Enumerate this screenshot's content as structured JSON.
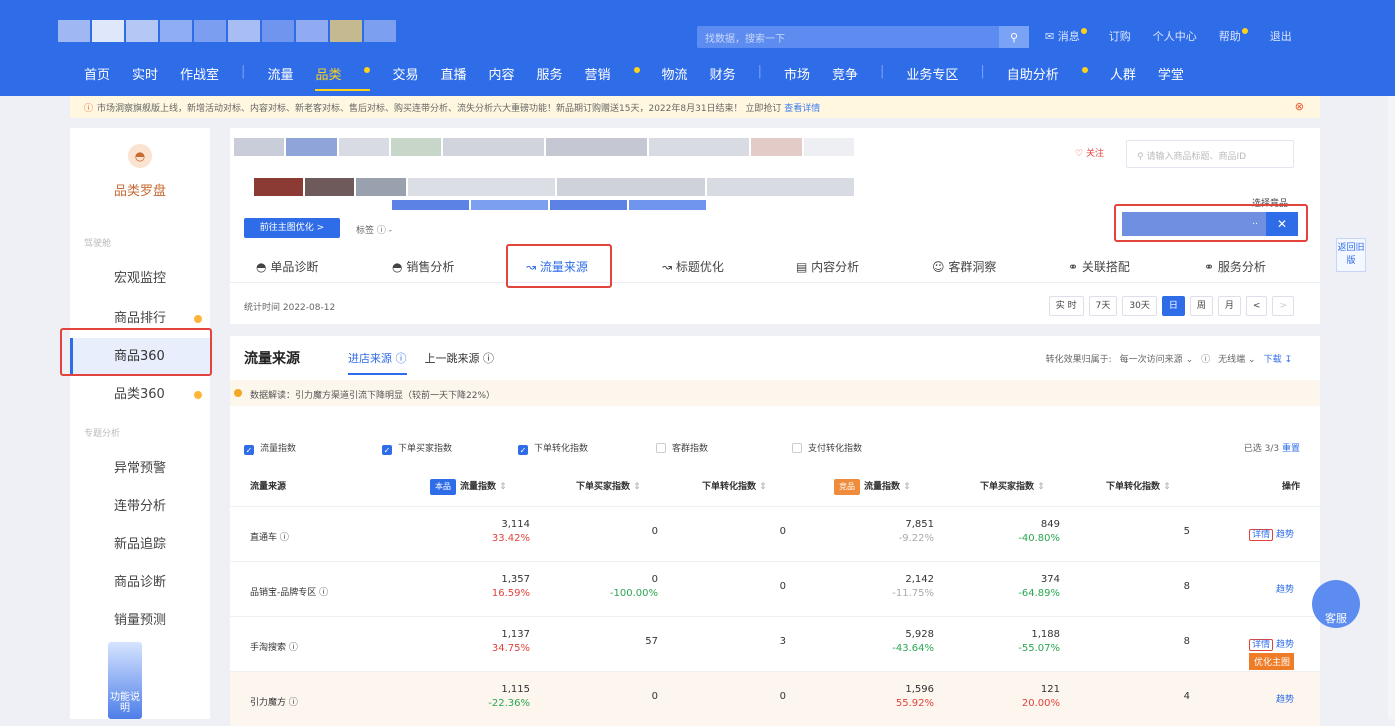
{
  "header": {
    "search_placeholder": "找数据，搜索一下",
    "links": [
      "消息",
      "订购",
      "个人中心",
      "帮助",
      "退出"
    ],
    "nav": [
      "首页",
      "实时",
      "作战室",
      "流量",
      "品类",
      "交易",
      "直播",
      "内容",
      "服务",
      "营销",
      "物流",
      "财务",
      "市场",
      "竞争",
      "业务专区",
      "自助分析",
      "人群",
      "学堂"
    ]
  },
  "notice": {
    "text": "市场洞察旗舰版上线，新增活动对标、内容对标、新老客对标、售后对标、购买连带分析、流失分析六大重磅功能！新品期订购赠送15天，2022年8月31日结束！ 立即抢订",
    "link": "查看详情"
  },
  "sidebar": {
    "title": "品类罗盘",
    "group1": "驾驶舱",
    "group2": "专题分析",
    "items": [
      "宏观监控",
      "商品排行",
      "商品360",
      "品类360",
      "异常预警",
      "连带分析",
      "新品追踪",
      "商品诊断",
      "销量预测"
    ],
    "helper": "功能说明"
  },
  "product": {
    "optimize_btn": "前往主图优化 >",
    "tag_label": "标签",
    "tag_value": "-",
    "follow": "关注",
    "search_placeholder": "请输入商品标题、商品ID",
    "choose_label": "选择竞品",
    "choose_dots": "..",
    "tabs": [
      "单品诊断",
      "销售分析",
      "流量来源",
      "标题优化",
      "内容分析",
      "客群洞察",
      "关联搭配",
      "服务分析"
    ],
    "date": "统计时间 2022-08-12",
    "periods": [
      "实 时",
      "7天",
      "30天",
      "日",
      "周",
      "月",
      "<",
      ">"
    ]
  },
  "traffic": {
    "title": "流量来源",
    "tabs": [
      "进店来源",
      "上一跳来源"
    ],
    "attribution_label": "转化效果归属于:",
    "attribution_value": "每一次访问来源",
    "device": "无线端",
    "download": "下载",
    "tip": "数据解读：引力魔方渠道引流下降明显（较前一天下降22%）",
    "checks": [
      "流量指数",
      "下单买家指数",
      "下单转化指数",
      "客群指数",
      "支付转化指数"
    ],
    "checked": [
      true,
      true,
      true,
      false,
      false
    ],
    "selected": "已选 3/3",
    "reset": "重置",
    "columns": {
      "source": "流量来源",
      "own_badge": "本品",
      "comp_badge": "竞品",
      "traffic": "流量指数",
      "buyers": "下单买家指数",
      "conv": "下单转化指数",
      "ops": "操作"
    },
    "rows": [
      {
        "source": "直通车",
        "t": "3,114",
        "tp": "33.42%",
        "b": "0",
        "bp": "",
        "c": "0",
        "ct": "7,851",
        "ctp": "-9.22%",
        "cb": "849",
        "cbp": "-40.80%",
        "cc": "5",
        "detail": "详情",
        "trend": "趋势",
        "opt": ""
      },
      {
        "source": "品销宝-品牌专区",
        "t": "1,357",
        "tp": "16.59%",
        "b": "0",
        "bp": "-100.00%",
        "c": "0",
        "ct": "2,142",
        "ctp": "-11.75%",
        "cb": "374",
        "cbp": "-64.89%",
        "cc": "8",
        "detail": "",
        "trend": "趋势",
        "opt": ""
      },
      {
        "source": "手淘搜索",
        "t": "1,137",
        "tp": "34.75%",
        "b": "57",
        "bp": "",
        "c": "3",
        "ct": "5,928",
        "ctp": "-43.64%",
        "cb": "1,188",
        "cbp": "-55.07%",
        "cc": "8",
        "detail": "详情",
        "trend": "趋势",
        "opt": "优化主图"
      },
      {
        "source": "引力魔方",
        "t": "1,115",
        "tp": "-22.36%",
        "b": "0",
        "bp": "",
        "c": "0",
        "ct": "1,596",
        "ctp": "55.92%",
        "cb": "121",
        "cbp": "20.00%",
        "cc": "4",
        "detail": "",
        "trend": "趋势",
        "opt": ""
      }
    ]
  },
  "float": {
    "back": "返回旧版",
    "service": "客服"
  },
  "colors": {
    "brand": "#2f6ce8",
    "warn": "#e2433c",
    "up": "#e2433c",
    "down": "#2aa651"
  }
}
